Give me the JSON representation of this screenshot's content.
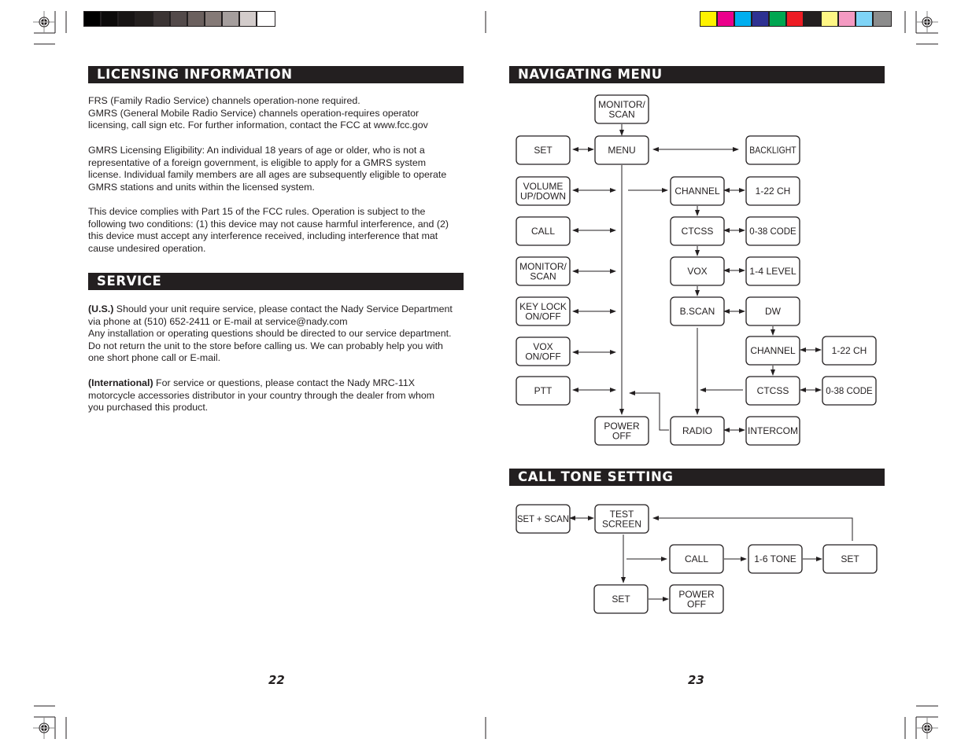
{
  "colors": {
    "ink": "#231f20",
    "grayscale_swatches": [
      "#000000",
      "#0c0a0a",
      "#171414",
      "#231f1e",
      "#3b3434",
      "#534a4a",
      "#6b605e",
      "#857a77",
      "#a59e9d",
      "#d3cccb",
      "#ffffff"
    ],
    "process_swatches": [
      "#fff200",
      "#ec008c",
      "#00aeef",
      "#2e3192",
      "#00a651",
      "#ed1c24",
      "#231f20",
      "#fff685",
      "#f49ac2",
      "#7fd4f7",
      "#8c8c8c"
    ]
  },
  "left_page": {
    "licensing": {
      "title": "LICENSING INFORMATION",
      "p1_lines": [
        "FRS (Family Radio Service) channels operation-none required.",
        "GMRS (General Mobile Radio Service) channels operation-requires operator",
        "licensing, call sign etc. For further information, contact the FCC at www.fcc.gov"
      ],
      "p2_lines": [
        "GMRS Licensing Eligibility: An individual 18 years of age or older, who is not a",
        "representative of a foreign government, is eligible to apply for a GMRS system",
        "license. Individual family members are all ages are subsequently eligible to operate",
        "GMRS stations and units within the licensed system."
      ],
      "p3_lines": [
        "This device complies with Part 15 of the FCC rules. Operation is subject to the",
        "following two conditions: (1) this device may not cause harmful interference, and (2)",
        "this device must accept any interference received, including interference that mat",
        "cause undesired operation."
      ]
    },
    "service": {
      "title": "SERVICE",
      "us_label": "(U.S.)",
      "us_lines": [
        " Should your unit require service, please contact the Nady Service Department",
        "via phone at (510) 652-2411 or E-mail at service@nady.com",
        "Any installation or operating questions should be directed to our service department.",
        "Do not return the unit to the store before calling us. We can probably help you with",
        "one short phone call or E-mail."
      ],
      "intl_label": "(International)",
      "intl_lines": [
        " For service or questions, please contact the Nady MRC-11X",
        "motorcycle accessories distributor in your country through the dealer from whom",
        "you purchased this product."
      ]
    },
    "page_number": "22"
  },
  "right_page": {
    "navigating_menu": {
      "title": "NAVIGATING MENU",
      "nodes": [
        {
          "id": "monitor-scan-top",
          "lines": [
            "MONITOR/",
            "SCAN"
          ]
        },
        {
          "id": "set",
          "lines": [
            "SET"
          ]
        },
        {
          "id": "menu",
          "lines": [
            "MENU"
          ]
        },
        {
          "id": "backlight",
          "lines": [
            "BACKLIGHT"
          ]
        },
        {
          "id": "volume",
          "lines": [
            "VOLUME",
            "UP/DOWN"
          ]
        },
        {
          "id": "channel",
          "lines": [
            "CHANNEL"
          ]
        },
        {
          "id": "ch-1-22",
          "lines": [
            "1-22 CH"
          ]
        },
        {
          "id": "call",
          "lines": [
            "CALL"
          ]
        },
        {
          "id": "ctcss",
          "lines": [
            "CTCSS"
          ]
        },
        {
          "id": "code-0-38",
          "lines": [
            "0-38 CODE"
          ]
        },
        {
          "id": "monitor-scan",
          "lines": [
            "MONITOR/",
            "SCAN"
          ]
        },
        {
          "id": "vox",
          "lines": [
            "VOX"
          ]
        },
        {
          "id": "level-1-4",
          "lines": [
            "1-4 LEVEL"
          ]
        },
        {
          "id": "key-lock",
          "lines": [
            "KEY LOCK",
            "ON/OFF"
          ]
        },
        {
          "id": "bscan",
          "lines": [
            "B.SCAN"
          ]
        },
        {
          "id": "dw",
          "lines": [
            "DW"
          ]
        },
        {
          "id": "vox-onoff",
          "lines": [
            "VOX",
            "ON/OFF"
          ]
        },
        {
          "id": "dw-channel",
          "lines": [
            "CHANNEL"
          ]
        },
        {
          "id": "dw-ch-1-22",
          "lines": [
            "1-22 CH"
          ]
        },
        {
          "id": "ptt",
          "lines": [
            "PTT"
          ]
        },
        {
          "id": "dw-ctcss",
          "lines": [
            "CTCSS"
          ]
        },
        {
          "id": "dw-code-0-38",
          "lines": [
            "0-38 CODE"
          ]
        },
        {
          "id": "power-off",
          "lines": [
            "POWER",
            "OFF"
          ]
        },
        {
          "id": "radio",
          "lines": [
            "RADIO"
          ]
        },
        {
          "id": "intercom",
          "lines": [
            "INTERCOM"
          ]
        }
      ]
    },
    "call_tone_setting": {
      "title": "CALL TONE SETTING",
      "nodes": [
        {
          "id": "set-scan",
          "lines": [
            "SET + SCAN"
          ]
        },
        {
          "id": "test-screen",
          "lines": [
            "TEST",
            "SCREEN"
          ]
        },
        {
          "id": "ct-call",
          "lines": [
            "CALL"
          ]
        },
        {
          "id": "tone-1-6",
          "lines": [
            "1-6 TONE"
          ]
        },
        {
          "id": "ct-set-right",
          "lines": [
            "SET"
          ]
        },
        {
          "id": "ct-set",
          "lines": [
            "SET"
          ]
        },
        {
          "id": "ct-power-off",
          "lines": [
            "POWER",
            "OFF"
          ]
        }
      ]
    },
    "page_number": "23"
  }
}
